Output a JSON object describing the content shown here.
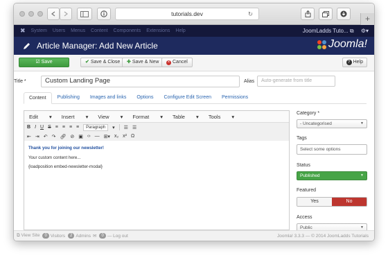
{
  "browser": {
    "url": "tutorials.dev"
  },
  "topbar": {
    "menu": [
      "System",
      "Users",
      "Menus",
      "Content",
      "Components",
      "Extensions",
      "Help"
    ],
    "site_name": "JoomLadds Tuto..."
  },
  "header": {
    "title": "Article Manager: Add New Article",
    "brand": "Joomla!"
  },
  "toolbar": {
    "save": "Save",
    "save_close": "Save & Close",
    "save_new": "Save & New",
    "cancel": "Cancel",
    "help": "Help"
  },
  "form": {
    "title_label": "Title *",
    "title_value": "Custom Landing Page",
    "alias_label": "Alias",
    "alias_placeholder": "Auto-generate from title"
  },
  "tabs": [
    "Content",
    "Publishing",
    "Images and links",
    "Options",
    "Configure Edit Screen",
    "Permissions"
  ],
  "editor": {
    "menus": [
      "Edit",
      "Insert",
      "View",
      "Format",
      "Table",
      "Tools"
    ],
    "paragraph": "Paragraph",
    "content": {
      "heading": "Thank you for joining our newsletter!",
      "line1": "Your custom content here...",
      "line2": "{loadposition embed-newsletter-modal}"
    }
  },
  "sidebar": {
    "category_label": "Category *",
    "category_value": "- Uncategorised",
    "tags_label": "Tags",
    "tags_placeholder": "Select some options",
    "status_label": "Status",
    "status_value": "Published",
    "featured_label": "Featured",
    "featured_yes": "Yes",
    "featured_no": "No",
    "access_label": "Access",
    "access_value": "Public"
  },
  "statusbar": {
    "view_site": "View Site",
    "visitors_count": "0",
    "visitors": "Visitors",
    "admins_count": "2",
    "admins": "Admins",
    "messages_count": "0",
    "logout": "Log out",
    "version": "Joomla! 3.3.3 — © 2014 JoomLadds Tutorials"
  },
  "colors": {
    "topbar": "#14183a",
    "header": "#1e2a5e",
    "save_green": "#47a447",
    "no_red": "#bd362f",
    "link_blue": "#2a65b0"
  }
}
